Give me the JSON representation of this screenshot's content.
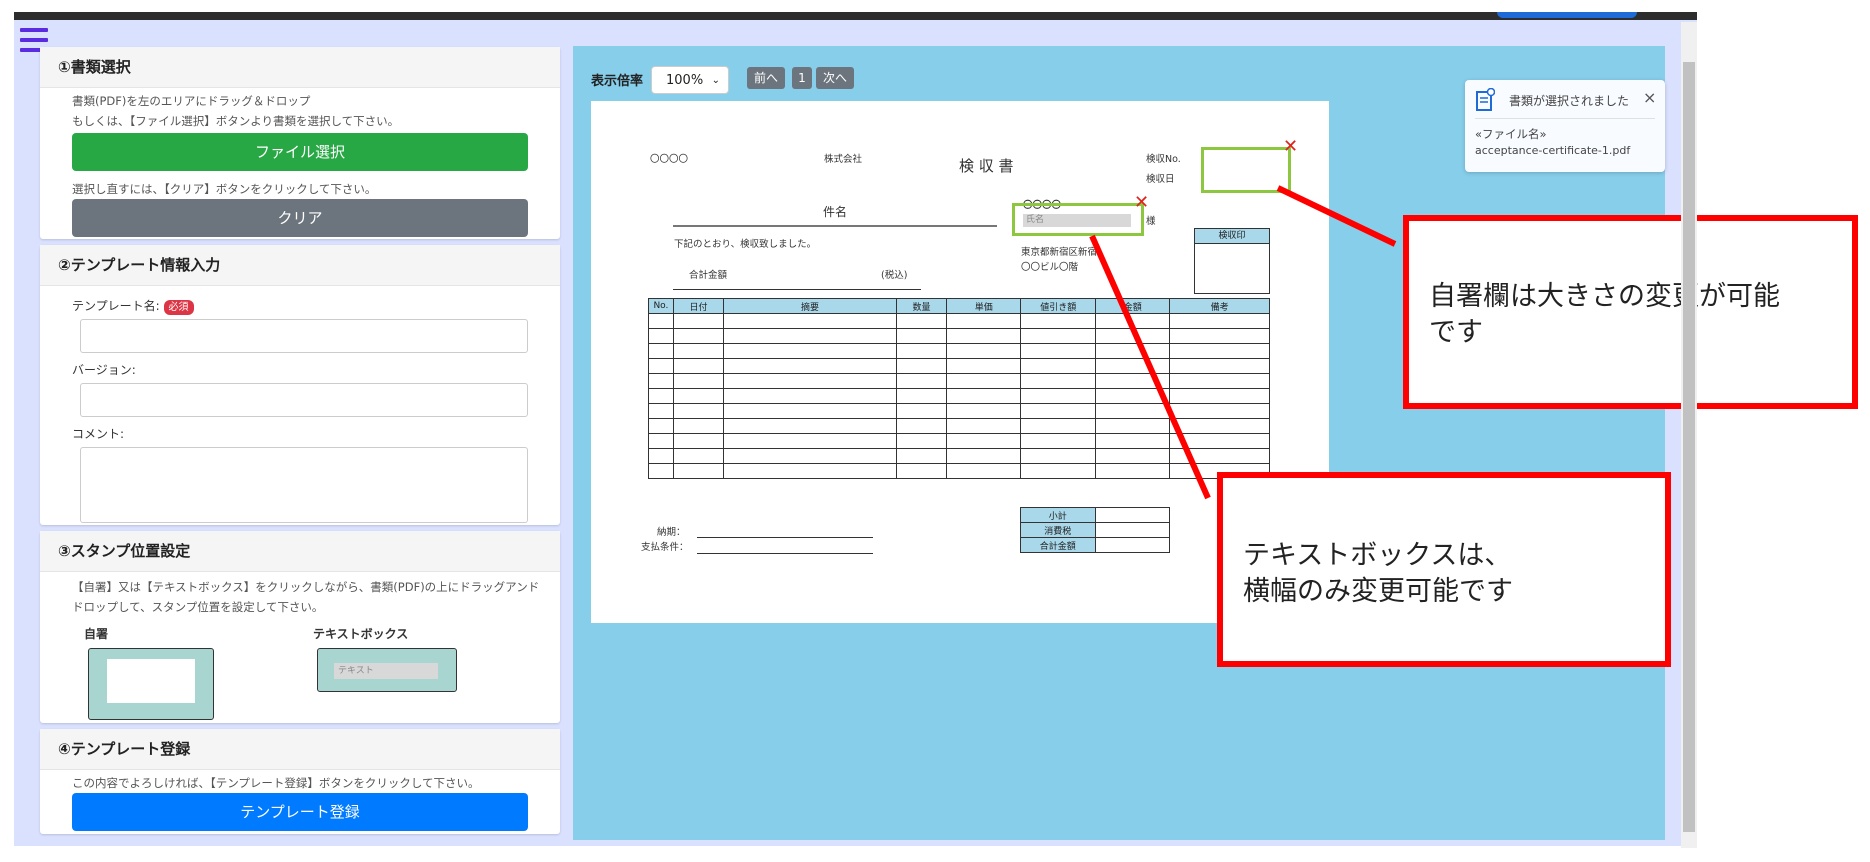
{
  "sections": {
    "doc_select": {
      "title": "①書類選択",
      "help1": "書類(PDF)を左のエリアにドラッグ＆ドロップ",
      "help2": "もしくは、【ファイル選択】ボタンより書類を選択して下さい。",
      "file_button": "ファイル選択",
      "help3": "選択し直すには、【クリア】ボタンをクリックして下さい。",
      "clear_button": "クリア"
    },
    "template_info": {
      "title": "②テンプレート情報入力",
      "name_label": "テンプレート名:",
      "required_badge": "必須",
      "version_label": "バージョン:",
      "comment_label": "コメント:"
    },
    "stamp": {
      "title": "③スタンプ位置設定",
      "help": "【自署】又は【テキストボックス】をクリックしながら、書類(PDF)の上にドラッグアンド",
      "help2": "ドロップして、スタンプ位置を設定して下さい。",
      "signature_label": "自署",
      "textbox_label": "テキストボックス",
      "textbox_placeholder": "テキスト"
    },
    "register": {
      "title": "④テンプレート登録",
      "help": "この内容でよろしければ、【テンプレート登録】ボタンをクリックして下さい。",
      "button": "テンプレート登録"
    }
  },
  "viewer": {
    "zoom_label": "表示倍率",
    "zoom_value": "100%",
    "prev_button": "前へ",
    "page": "1",
    "next_button": "次へ"
  },
  "document": {
    "company_placeholder": "〇〇〇〇",
    "company_suffix": "株式会社",
    "title": "検 収 書",
    "no_label": "検収No.",
    "date_label": "検収日",
    "subject_label": "件名",
    "name_field": "氏名",
    "name_mark": "〇〇〇〇",
    "honorific": "様",
    "receipt_note": "下記のとおり、検収致しました。",
    "address1": "東京都新宿区新宿",
    "address2": "〇〇ビル〇階",
    "stamp_label": "検収印",
    "total_label": "合計金額",
    "tax_label": "(税込)",
    "columns": [
      "No.",
      "日付",
      "摘要",
      "数量",
      "単価",
      "値引き額",
      "金額",
      "備考"
    ],
    "subtotal_labels": [
      "小計",
      "消費税",
      "合計金額"
    ],
    "notes_label": "納期：",
    "payment_label": "支払条件："
  },
  "toast": {
    "title": "書類が選択されました",
    "close": "×",
    "file_label": "«ファイル名»",
    "file_name": "acceptance-certificate-1.pdf"
  },
  "callouts": {
    "signature": [
      "自署欄は大きさの変更が可能",
      "です"
    ],
    "textbox": [
      "テキストボックスは、",
      "横幅のみ変更可能です"
    ]
  },
  "colors": {
    "file_button": "#28a745",
    "clear_button": "#6c757d",
    "register_button": "#007bff",
    "viewer_bg": "#87ceeb",
    "callout_border": "#ff0000",
    "stamp_border": "#8dc63f"
  }
}
